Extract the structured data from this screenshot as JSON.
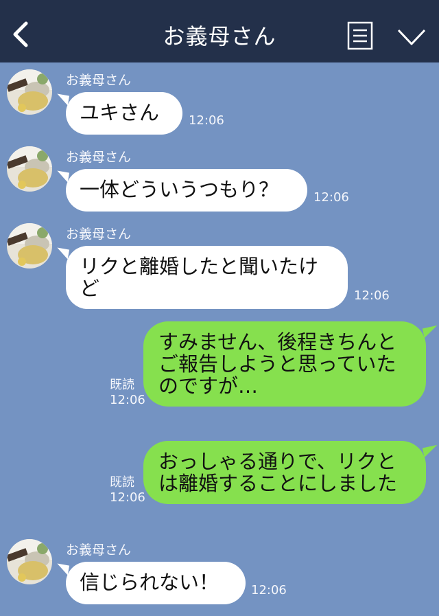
{
  "header": {
    "title": "お義母さん",
    "back_icon": "chevron-left-icon",
    "menu_icon": "menu-list-icon",
    "more_icon": "chevron-down-icon"
  },
  "messages": [
    {
      "sender": "お義母さん",
      "text": "ユキさん",
      "time": "12:06"
    },
    {
      "sender": "お義母さん",
      "text": "一体どういうつもり？",
      "time": "12:06"
    },
    {
      "sender": "お義母さん",
      "line1": "リクと離婚したと聞いたけ",
      "line2": "ど",
      "time": "12:06"
    },
    {
      "status": "既読",
      "line1": "すみません、後程きちんと",
      "line2": "ご報告しようと思っていた",
      "line3": "のですが…",
      "time": "12:06"
    },
    {
      "status": "既読",
      "line1": "おっしゃる通りで、リクと",
      "line2": "は離婚することにしました",
      "time": "12:06"
    },
    {
      "sender": "お義母さん",
      "text": "信じられない！",
      "time": "12:06"
    }
  ]
}
